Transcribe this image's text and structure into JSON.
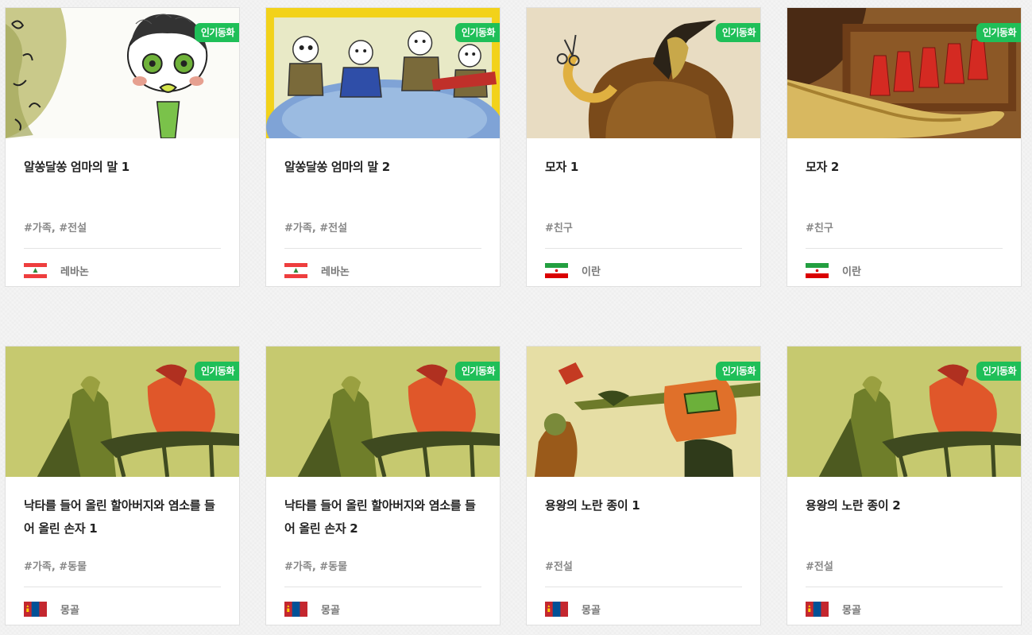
{
  "cards": [
    {
      "badge": "인기동화",
      "title": "알쏭달쏭 엄마의 말 1",
      "tags": "#가족, #전설",
      "country": "레바논",
      "flag_icon": "lebanon-flag-icon",
      "thumb_icon": "illustration-green-haired-boy"
    },
    {
      "badge": "인기동화",
      "title": "알쏭달쏭 엄마의 말 2",
      "tags": "#가족, #전설",
      "country": "레바논",
      "flag_icon": "lebanon-flag-icon",
      "thumb_icon": "illustration-men-at-table"
    },
    {
      "badge": "인기동화",
      "title": "모자 1",
      "tags": "#친구",
      "country": "이란",
      "flag_icon": "iran-flag-icon",
      "thumb_icon": "illustration-hatted-figure"
    },
    {
      "badge": "인기동화",
      "title": "모자 2",
      "tags": "#친구",
      "country": "이란",
      "flag_icon": "iran-flag-icon",
      "thumb_icon": "illustration-red-hats"
    },
    {
      "badge": "인기동화",
      "title": "낙타를 들어 올린 할아버지와 염소를 들어 올린 손자 1",
      "tags": "#가족, #동물",
      "country": "몽골",
      "flag_icon": "mongolia-flag-icon",
      "thumb_icon": "illustration-riders"
    },
    {
      "badge": "인기동화",
      "title": "낙타를 들어 올린 할아버지와 염소를 들어 올린 손자 2",
      "tags": "#가족, #동물",
      "country": "몽골",
      "flag_icon": "mongolia-flag-icon",
      "thumb_icon": "illustration-riders"
    },
    {
      "badge": "인기동화",
      "title": "용왕의 노란 종이 1",
      "tags": "#전설",
      "country": "몽골",
      "flag_icon": "mongolia-flag-icon",
      "thumb_icon": "illustration-dragon-king"
    },
    {
      "badge": "인기동화",
      "title": "용왕의 노란 종이 2",
      "tags": "#전설",
      "country": "몽골",
      "flag_icon": "mongolia-flag-icon",
      "thumb_icon": "illustration-riders"
    }
  ],
  "colors": {
    "badge": "#1fbf58",
    "title": "#222222",
    "tags": "#888888",
    "country": "#777777"
  }
}
